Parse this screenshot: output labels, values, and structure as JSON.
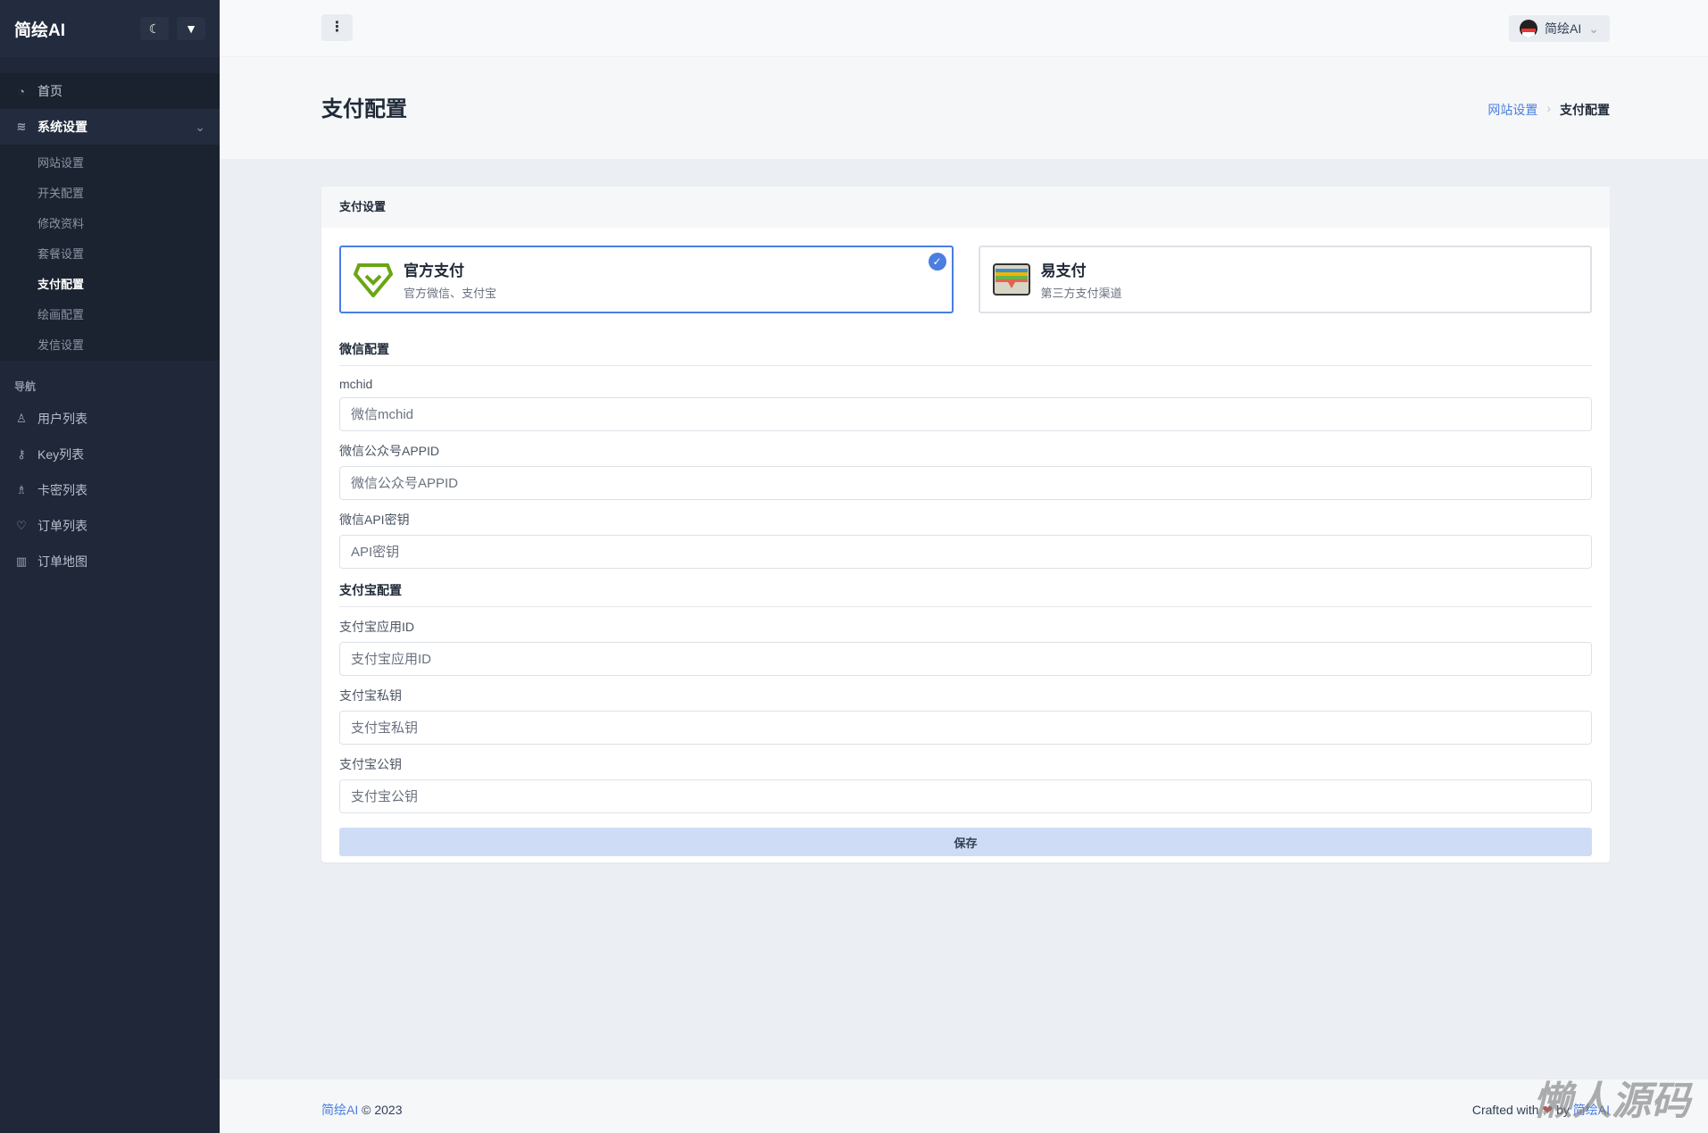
{
  "sidebar": {
    "brand": "简绘AI",
    "theme_icon": "moon-icon",
    "pin_icon": "pin-icon",
    "home": "首页",
    "system": "系统设置",
    "sub": [
      "网站设置",
      "开关配置",
      "修改资料",
      "套餐设置",
      "支付配置",
      "绘画配置",
      "发信设置"
    ],
    "nav_heading": "导航",
    "nav": [
      "用户列表",
      "Key列表",
      "卡密列表",
      "订单列表",
      "订单地图"
    ]
  },
  "topbar": {
    "menu": "⋮",
    "user": "简绘AI"
  },
  "page": {
    "title": "支付配置",
    "breadcrumb": [
      "网站设置",
      "支付配置"
    ]
  },
  "card": {
    "title": "支付设置",
    "options": [
      {
        "title": "官方支付",
        "desc": "官方微信、支付宝",
        "selected": true
      },
      {
        "title": "易支付",
        "desc": "第三方支付渠道",
        "selected": false
      }
    ],
    "wechat_section": "微信配置",
    "wechat_fields": [
      {
        "label": "mchid",
        "placeholder": "微信mchid"
      },
      {
        "label": "微信公众号APPID",
        "placeholder": "微信公众号APPID"
      },
      {
        "label": "微信API密钥",
        "placeholder": "API密钥"
      }
    ],
    "alipay_section": "支付宝配置",
    "alipay_fields": [
      {
        "label": "支付宝应用ID",
        "placeholder": "支付宝应用ID"
      },
      {
        "label": "支付宝私钥",
        "placeholder": "支付宝私钥"
      },
      {
        "label": "支付宝公钥",
        "placeholder": "支付宝公钥"
      }
    ],
    "save": "保存"
  },
  "footer": {
    "brand": "简绘AI",
    "copy": "© 2023",
    "crafted": "Crafted with",
    "by": "by",
    "author": "简绘AI"
  },
  "watermark": "懒人源码",
  "colors": {
    "accent": "#4a7ee0",
    "sidebar": "#1f2738"
  }
}
